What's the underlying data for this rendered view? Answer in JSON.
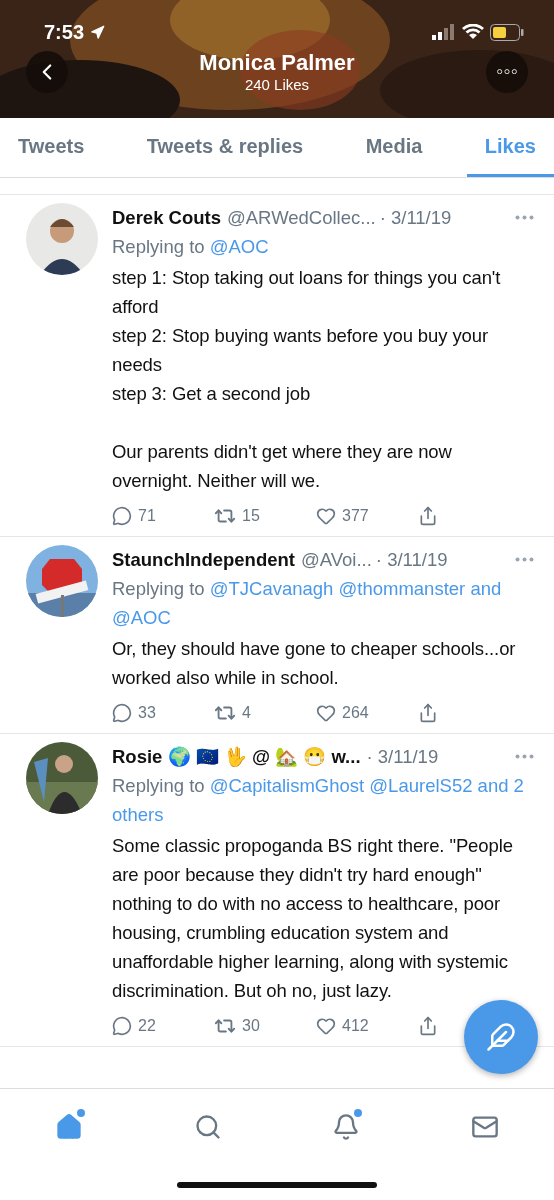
{
  "status_bar": {
    "time": "7:53"
  },
  "header": {
    "name": "Monica Palmer",
    "subtitle": "240 Likes"
  },
  "tabs": [
    {
      "label": "Tweets",
      "selected": false
    },
    {
      "label": "Tweets & replies",
      "selected": false
    },
    {
      "label": "Media",
      "selected": false
    },
    {
      "label": "Likes",
      "selected": true
    }
  ],
  "tweets": [
    {
      "name": "Derek Couts",
      "handle": "@ARWedCollec...",
      "date": "· 3/11/19",
      "reply_label": "Replying to",
      "reply_to": "@AOC",
      "text": "step 1: Stop taking out loans for things you can't afford\nstep 2: Stop buying wants before you buy your needs\nstep 3: Get a second job\n\nOur parents didn't get where they are now overnight. Neither will we.",
      "replies": "71",
      "retweets": "15",
      "likes": "377"
    },
    {
      "name": "StaunchIndependent",
      "handle": "@AVoi...",
      "date": "· 3/11/19",
      "reply_label": "Replying to",
      "reply_to": "@TJCavanagh @thommanster and @AOC",
      "text": "Or, they should have gone to cheaper schools...or worked also while in school.",
      "replies": "33",
      "retweets": "4",
      "likes": "264"
    },
    {
      "name": "Rosie 🌍 🇪🇺 🖖 @ 🏡 😷 w...",
      "date": "· 3/11/19",
      "reply_label": "Replying to",
      "reply_to": "@CapitalismGhost @LaurelS52 and 2 others",
      "text": "Some classic propoganda BS right there. \"People are poor because they didn't try hard enough\" nothing to do with no access to healthcare, poor housing, crumbling education system and unaffordable higher learning, along with systemic discrimination. But oh no, just lazy.",
      "replies": "22",
      "retweets": "30",
      "likes": "412"
    }
  ],
  "bottom_nav": [
    {
      "kind": "home",
      "selected": true,
      "badge": true
    },
    {
      "kind": "search",
      "selected": false,
      "badge": false
    },
    {
      "kind": "notifications",
      "selected": false,
      "badge": true
    },
    {
      "kind": "messages",
      "selected": false,
      "badge": false
    }
  ]
}
